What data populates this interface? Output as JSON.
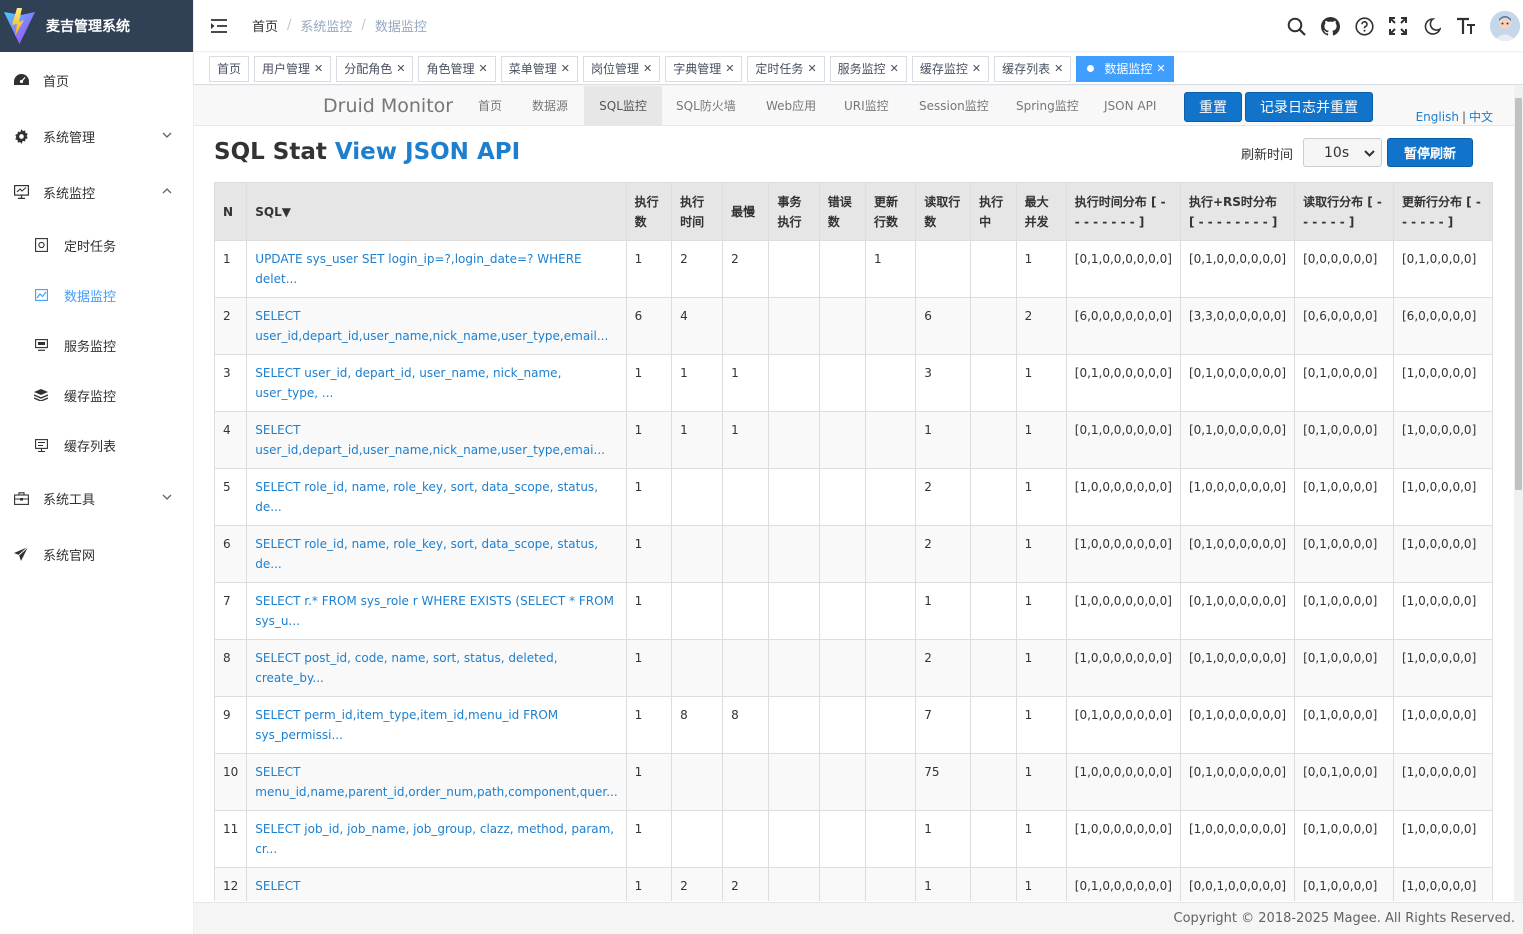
{
  "app": {
    "title": "麦吉管理系统"
  },
  "sidebar": {
    "items": [
      {
        "label": "首页",
        "icon": "dashboard-icon"
      },
      {
        "label": "系统管理",
        "icon": "gear-icon"
      },
      {
        "label": "系统监控",
        "icon": "monitor-icon"
      },
      {
        "label": "系统工具",
        "icon": "toolbox-icon"
      },
      {
        "label": "系统官网",
        "icon": "send-icon"
      }
    ],
    "sub_items": [
      {
        "label": "定时任务",
        "icon": "job-icon"
      },
      {
        "label": "数据监控",
        "icon": "chart-icon"
      },
      {
        "label": "服务监控",
        "icon": "server-icon"
      },
      {
        "label": "缓存监控",
        "icon": "redis-icon"
      },
      {
        "label": "缓存列表",
        "icon": "list-icon"
      }
    ]
  },
  "breadcrumb": [
    "首页",
    "系统监控",
    "数据监控"
  ],
  "tags": [
    "首页",
    "用户管理",
    "分配角色",
    "角色管理",
    "菜单管理",
    "岗位管理",
    "字典管理",
    "定时任务",
    "服务监控",
    "缓存监控",
    "缓存列表",
    "数据监控"
  ],
  "druid": {
    "brand": "Druid Monitor",
    "nav": [
      "首页",
      "数据源",
      "SQL监控",
      "SQL防火墙",
      "Web应用",
      "URI监控",
      "Session监控",
      "Spring监控",
      "JSON API"
    ],
    "reset": "重置",
    "log_reset": "记录日志并重置",
    "lang_en": "English",
    "lang_sep": "|",
    "lang_zh": "中文"
  },
  "page": {
    "title": "SQL Stat",
    "title_link": "View JSON API",
    "refresh_label": "刷新时间",
    "refresh_value": "10s",
    "pause": "暂停刷新"
  },
  "table": {
    "headers": [
      "N",
      "SQL▼",
      "执行数",
      "执行时间",
      "最慢",
      "事务执行",
      "错误数",
      "更新行数",
      "读取行数",
      "执行中",
      "最大并发",
      "执行时间分布 [ - - - - - - - - ]",
      "执行+RS时分布 [ - - - - - - - - ]",
      "读取行分布 [ - - - - - - ]",
      "更新行分布 [ - - - - - - ]"
    ],
    "rows": [
      [
        "1",
        "UPDATE sys_user SET login_ip=?,login_date=? WHERE delet...",
        "1",
        "2",
        "2",
        "",
        "",
        "1",
        "",
        "",
        "1",
        "[0,1,0,0,0,0,0,0]",
        "[0,1,0,0,0,0,0,0]",
        "[0,0,0,0,0,0]",
        "[0,1,0,0,0,0]"
      ],
      [
        "2",
        "SELECT user_id,depart_id,user_name,nick_name,user_type,email...",
        "6",
        "4",
        "",
        "",
        "",
        "",
        "6",
        "",
        "2",
        "[6,0,0,0,0,0,0,0]",
        "[3,3,0,0,0,0,0,0]",
        "[0,6,0,0,0,0]",
        "[6,0,0,0,0,0]"
      ],
      [
        "3",
        "SELECT user_id, depart_id, user_name, nick_name, user_type, ...",
        "1",
        "1",
        "1",
        "",
        "",
        "",
        "3",
        "",
        "1",
        "[0,1,0,0,0,0,0,0]",
        "[0,1,0,0,0,0,0,0]",
        "[0,1,0,0,0,0]",
        "[1,0,0,0,0,0]"
      ],
      [
        "4",
        "SELECT user_id,depart_id,user_name,nick_name,user_type,emai...",
        "1",
        "1",
        "1",
        "",
        "",
        "",
        "1",
        "",
        "1",
        "[0,1,0,0,0,0,0,0]",
        "[0,1,0,0,0,0,0,0]",
        "[0,1,0,0,0,0]",
        "[1,0,0,0,0,0]"
      ],
      [
        "5",
        "SELECT role_id, name, role_key, sort, data_scope, status, de...",
        "1",
        "",
        "",
        "",
        "",
        "",
        "2",
        "",
        "1",
        "[1,0,0,0,0,0,0,0]",
        "[1,0,0,0,0,0,0,0]",
        "[0,1,0,0,0,0]",
        "[1,0,0,0,0,0]"
      ],
      [
        "6",
        "SELECT role_id, name, role_key, sort, data_scope, status, de...",
        "1",
        "",
        "",
        "",
        "",
        "",
        "2",
        "",
        "1",
        "[1,0,0,0,0,0,0,0]",
        "[0,1,0,0,0,0,0,0]",
        "[0,1,0,0,0,0]",
        "[1,0,0,0,0,0]"
      ],
      [
        "7",
        "SELECT r.* FROM sys_role r WHERE EXISTS (SELECT * FROM sys_u...",
        "1",
        "",
        "",
        "",
        "",
        "",
        "1",
        "",
        "1",
        "[1,0,0,0,0,0,0,0]",
        "[0,1,0,0,0,0,0,0]",
        "[0,1,0,0,0,0]",
        "[1,0,0,0,0,0]"
      ],
      [
        "8",
        "SELECT post_id, code, name, sort, status, deleted, create_by...",
        "1",
        "",
        "",
        "",
        "",
        "",
        "2",
        "",
        "1",
        "[1,0,0,0,0,0,0,0]",
        "[0,1,0,0,0,0,0,0]",
        "[0,1,0,0,0,0]",
        "[1,0,0,0,0,0]"
      ],
      [
        "9",
        "SELECT perm_id,item_type,item_id,menu_id FROM sys_permissi...",
        "1",
        "8",
        "8",
        "",
        "",
        "",
        "7",
        "",
        "1",
        "[0,1,0,0,0,0,0,0]",
        "[0,1,0,0,0,0,0,0]",
        "[0,1,0,0,0,0]",
        "[1,0,0,0,0,0]"
      ],
      [
        "10",
        "SELECT menu_id,name,parent_id,order_num,path,component,quer...",
        "1",
        "",
        "",
        "",
        "",
        "",
        "75",
        "",
        "1",
        "[1,0,0,0,0,0,0,0]",
        "[0,1,0,0,0,0,0,0]",
        "[0,0,1,0,0,0]",
        "[1,0,0,0,0,0]"
      ],
      [
        "11",
        "SELECT job_id, job_name, job_group, clazz, method, param, cr...",
        "1",
        "",
        "",
        "",
        "",
        "",
        "1",
        "",
        "1",
        "[1,0,0,0,0,0,0,0]",
        "[1,0,0,0,0,0,0,0]",
        "[0,1,0,0,0,0]",
        "[1,0,0,0,0,0]"
      ],
      [
        "12",
        "SELECT",
        "1",
        "2",
        "2",
        "",
        "",
        "",
        "1",
        "",
        "1",
        "[0,1,0,0,0,0,0,0]",
        "[0,0,1,0,0,0,0,0]",
        "[0,1,0,0,0,0]",
        "[1,0,0,0,0,0]"
      ]
    ]
  },
  "footer": {
    "copyright": "Copyright © 2018-2025 Magee. All Rights Reserved."
  }
}
